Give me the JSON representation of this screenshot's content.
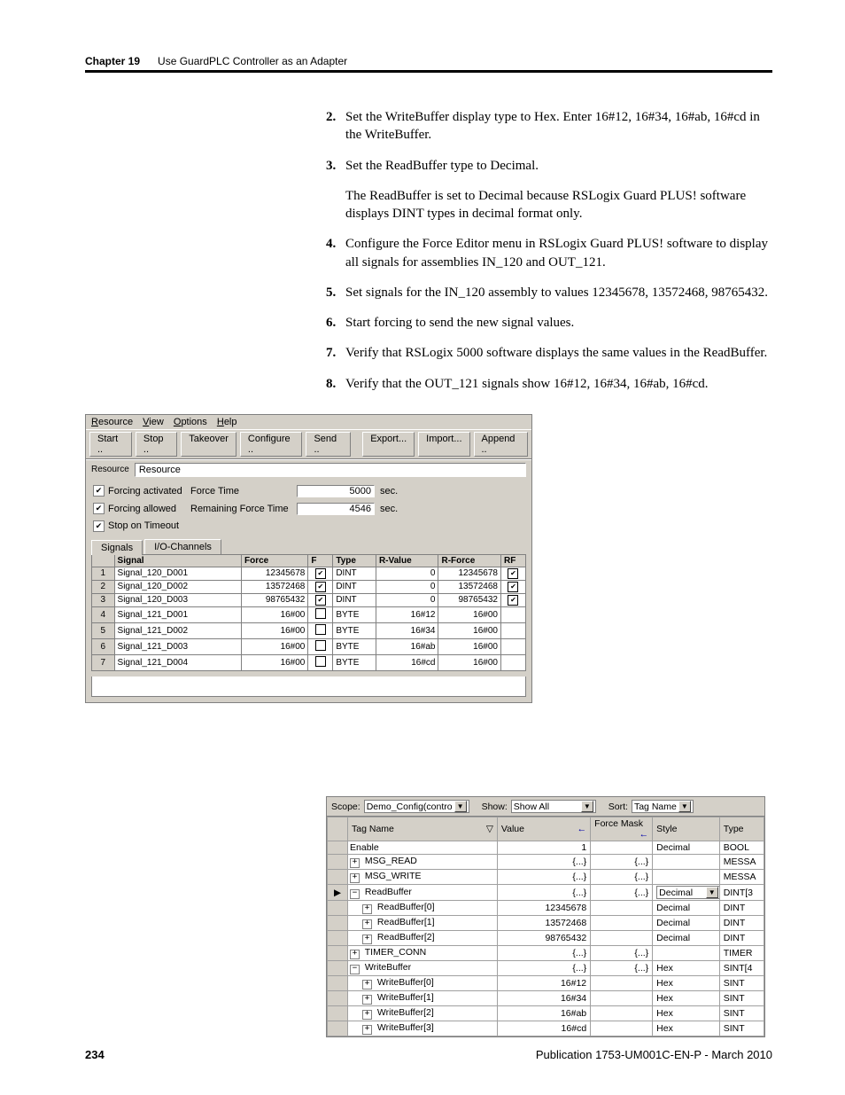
{
  "header": {
    "chapter": "Chapter 19",
    "title": "Use GuardPLC Controller as an Adapter"
  },
  "steps": {
    "s2": {
      "n": "2.",
      "t": "Set the WriteBuffer display type to Hex. Enter 16#12, 16#34, 16#ab, 16#cd in the WriteBuffer."
    },
    "s3": {
      "n": "3.",
      "t": "Set the ReadBuffer type to Decimal."
    },
    "p3a": "The ReadBuffer is set to Decimal because RSLogix Guard PLUS! software displays DINT types in decimal format only.",
    "s4": {
      "n": "4.",
      "t": "Configure the Force Editor menu in RSLogix Guard PLUS! software to display all signals for assemblies IN_120 and OUT_121."
    },
    "s5": {
      "n": "5.",
      "t": "Set signals for the IN_120 assembly to values 12345678, 13572468, 98765432."
    },
    "s6": {
      "n": "6.",
      "t": "Start forcing to send the new signal values."
    },
    "s7": {
      "n": "7.",
      "t": "Verify that RSLogix 5000 software displays the same values in the ReadBuffer."
    },
    "s8": {
      "n": "8.",
      "t": "Verify that the OUT_121 signals show 16#12, 16#34, 16#ab, 16#cd."
    }
  },
  "fe": {
    "menu": {
      "resource": "Resource",
      "view": "View",
      "options": "Options",
      "help": "Help"
    },
    "tb": {
      "start": "Start ..",
      "stop": "Stop ..",
      "takeover": "Takeover",
      "configure": "Configure ..",
      "send": "Send ..",
      "export": "Export...",
      "import": "Import...",
      "append": "Append .."
    },
    "res_lbl": "Resource",
    "res_val": "Resource",
    "opt": {
      "forcing_act": "Forcing activated",
      "forcing_allowed": "Forcing allowed",
      "stop_timeout": "Stop on Timeout",
      "force_time": "Force Time",
      "remaining": "Remaining Force Time",
      "ft_val": "5000",
      "rft_val": "4546",
      "sec": "sec."
    },
    "tabs": {
      "signals": "Signals",
      "io": "I/O-Channels"
    },
    "head": {
      "signal": "Signal",
      "force": "Force",
      "f": "F",
      "type": "Type",
      "rvalue": "R-Value",
      "rforce": "R-Force",
      "rf": "RF"
    },
    "rows": [
      {
        "n": "1",
        "sig": "Signal_120_D001",
        "force": "12345678",
        "f": true,
        "type": "DINT",
        "rv": "0",
        "rf": "12345678",
        "rfc": true
      },
      {
        "n": "2",
        "sig": "Signal_120_D002",
        "force": "13572468",
        "f": true,
        "type": "DINT",
        "rv": "0",
        "rf": "13572468",
        "rfc": true
      },
      {
        "n": "3",
        "sig": "Signal_120_D003",
        "force": "98765432",
        "f": true,
        "type": "DINT",
        "rv": "0",
        "rf": "98765432",
        "rfc": true
      },
      {
        "n": "4",
        "sig": "Signal_121_D001",
        "force": "16#00",
        "f": false,
        "type": "BYTE",
        "rv": "16#12",
        "rf": "16#00",
        "rfc": false
      },
      {
        "n": "5",
        "sig": "Signal_121_D002",
        "force": "16#00",
        "f": false,
        "type": "BYTE",
        "rv": "16#34",
        "rf": "16#00",
        "rfc": false
      },
      {
        "n": "6",
        "sig": "Signal_121_D003",
        "force": "16#00",
        "f": false,
        "type": "BYTE",
        "rv": "16#ab",
        "rf": "16#00",
        "rfc": false
      },
      {
        "n": "7",
        "sig": "Signal_121_D004",
        "force": "16#00",
        "f": false,
        "type": "BYTE",
        "rv": "16#cd",
        "rf": "16#00",
        "rfc": false
      }
    ]
  },
  "tags": {
    "scope_lbl": "Scope:",
    "scope_val": "Demo_Config(contro",
    "show_lbl": "Show:",
    "show_val": "Show All",
    "sort_lbl": "Sort:",
    "sort_val": "Tag Name",
    "head": {
      "tag": "Tag Name",
      "value": "Value",
      "fm": "Force Mask",
      "style": "Style",
      "type": "Type"
    },
    "rows": [
      {
        "ind": 0,
        "tog": "",
        "tag": "Enable",
        "val": "1",
        "fm": "",
        "style": "Decimal",
        "type": "BOOL"
      },
      {
        "ind": 0,
        "tog": "+",
        "tag": "MSG_READ",
        "val": "{...}",
        "fm": "{...}",
        "style": "",
        "type": "MESSA"
      },
      {
        "ind": 0,
        "tog": "+",
        "tag": "MSG_WRITE",
        "val": "{...}",
        "fm": "{...}",
        "style": "",
        "type": "MESSA"
      },
      {
        "ind": 0,
        "tog": "−",
        "tag": "ReadBuffer",
        "val": "{...}",
        "fm": "{...}",
        "style": "Decimal",
        "type": "DINT[3"
      },
      {
        "ind": 1,
        "tog": "+",
        "tag": "ReadBuffer[0]",
        "val": "12345678",
        "fm": "",
        "style": "Decimal",
        "type": "DINT"
      },
      {
        "ind": 1,
        "tog": "+",
        "tag": "ReadBuffer[1]",
        "val": "13572468",
        "fm": "",
        "style": "Decimal",
        "type": "DINT"
      },
      {
        "ind": 1,
        "tog": "+",
        "tag": "ReadBuffer[2]",
        "val": "98765432",
        "fm": "",
        "style": "Decimal",
        "type": "DINT"
      },
      {
        "ind": 0,
        "tog": "+",
        "tag": "TIMER_CONN",
        "val": "{...}",
        "fm": "{...}",
        "style": "",
        "type": "TIMER"
      },
      {
        "ind": 0,
        "tog": "−",
        "tag": "WriteBuffer",
        "val": "{...}",
        "fm": "{...}",
        "style": "Hex",
        "type": "SINT[4"
      },
      {
        "ind": 1,
        "tog": "+",
        "tag": "WriteBuffer[0]",
        "val": "16#12",
        "fm": "",
        "style": "Hex",
        "type": "SINT"
      },
      {
        "ind": 1,
        "tog": "+",
        "tag": "WriteBuffer[1]",
        "val": "16#34",
        "fm": "",
        "style": "Hex",
        "type": "SINT"
      },
      {
        "ind": 1,
        "tog": "+",
        "tag": "WriteBuffer[2]",
        "val": "16#ab",
        "fm": "",
        "style": "Hex",
        "type": "SINT"
      },
      {
        "ind": 1,
        "tog": "+",
        "tag": "WriteBuffer[3]",
        "val": "16#cd",
        "fm": "",
        "style": "Hex",
        "type": "SINT"
      }
    ]
  },
  "footer": {
    "page": "234",
    "pub": "Publication 1753-UM001C-EN-P - March 2010"
  }
}
